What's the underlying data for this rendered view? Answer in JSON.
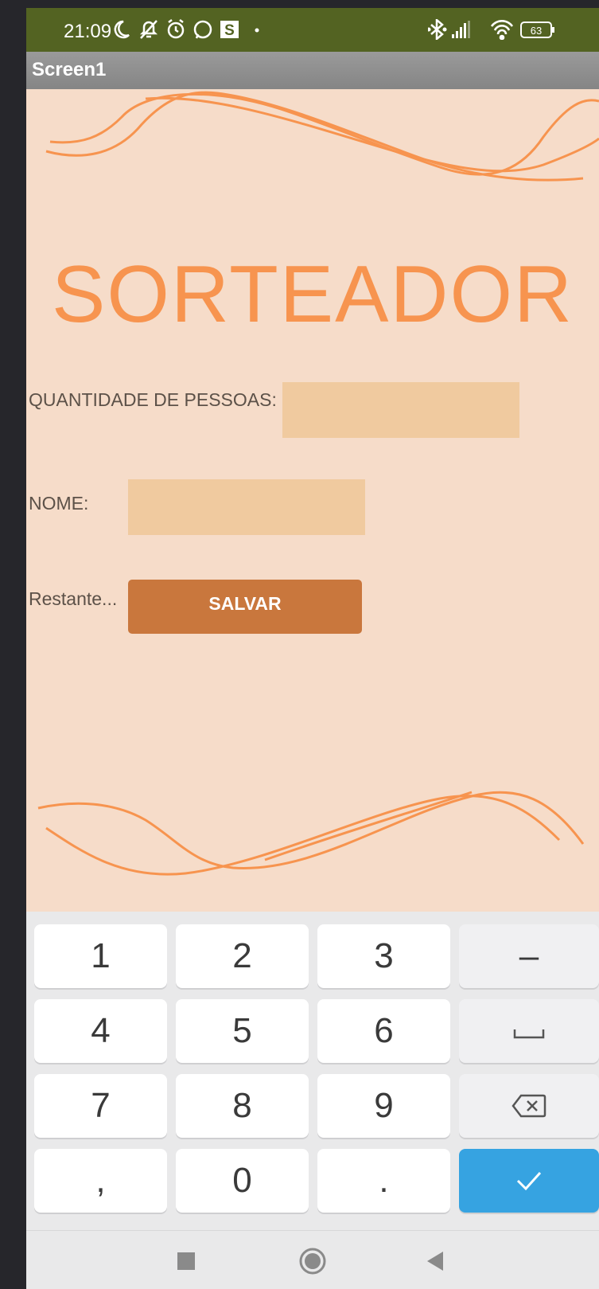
{
  "status_bar": {
    "time": "21:09",
    "left_icons": [
      "moon-icon",
      "bell-off-icon",
      "alarm-icon",
      "whatsapp-icon",
      "s-app-icon",
      "dot-icon"
    ],
    "right_icons": [
      "bluetooth-icon",
      "signal-icon",
      "wifi-icon",
      "battery-icon"
    ],
    "battery": "63"
  },
  "title_bar": {
    "title": "Screen1"
  },
  "app": {
    "title": "SORTEADOR",
    "people_label": "QUANTIDADE DE PESSOAS:",
    "people_value": "",
    "name_label": "NOME:",
    "name_value": "",
    "remaining_label": "Restante...",
    "save_label": "SALVAR"
  },
  "keyboard": {
    "rows": [
      [
        "1",
        "2",
        "3",
        "–"
      ],
      [
        "4",
        "5",
        "6",
        "space-icon"
      ],
      [
        "7",
        "8",
        "9",
        "backspace-icon"
      ],
      [
        ",",
        "0",
        ".",
        "check-icon"
      ]
    ]
  },
  "nav": [
    "recents-icon",
    "home-icon",
    "back-icon"
  ],
  "colors": {
    "status_bar": "#536322",
    "background": "#f6dcc9",
    "title": "#f7944f",
    "field": "#f0ca9f",
    "button": "#c9773d",
    "enter_key": "#36a3e1"
  }
}
